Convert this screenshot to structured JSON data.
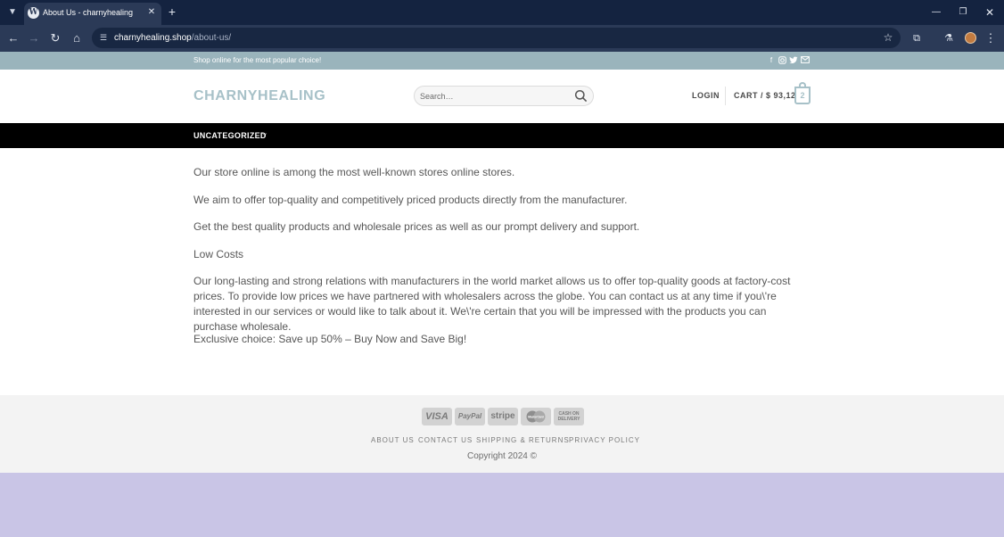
{
  "browser": {
    "tab_title": "About Us - charnyhealing",
    "url_host": "charnyhealing.shop",
    "url_path": "/about-us/"
  },
  "topbar": {
    "text": "Shop online for the most popular choice!",
    "social": [
      "facebook-icon",
      "instagram-icon",
      "twitter-icon",
      "email-icon"
    ]
  },
  "header": {
    "logo": "CHARNYHEALING",
    "search_placeholder": "Search…",
    "login": "LOGIN",
    "cart_label": "CART / $ 93,12",
    "cart_count": "2"
  },
  "nav": {
    "items": [
      {
        "label": "UNCATEGORIZED"
      }
    ]
  },
  "content": {
    "paragraphs": [
      "Our store online is among the most well-known stores online stores.",
      "We aim to offer top-quality and competitively priced products directly from the manufacturer.",
      "Get the best quality products and wholesale prices as well as our prompt delivery and support.",
      "Low Costs",
      "Our long-lasting and strong relations with manufacturers in the world market allows us to offer top-quality goods at factory-cost prices. To provide low prices we have partnered with wholesalers across the globe. You can contact us at any time if you\\'re interested in our services or would like to talk about it. We\\'re certain that you will be impressed with the products you can purchase wholesale.",
      "Exclusive choice: Save up 50% – Buy Now and Save Big!"
    ]
  },
  "footer": {
    "payments": [
      "VISA",
      "PayPal",
      "stripe",
      "MasterCard",
      "CASH ON DELIVERY"
    ],
    "links": [
      "ABOUT US",
      "CONTACT US",
      "SHIPPING & RETURNS",
      "PRIVACY POLICY"
    ],
    "copyright": "Copyright 2024 ©"
  },
  "colors": {
    "accent": "#a7c1c8",
    "topbar": "#9ab4bc",
    "nav_background": "#000000",
    "browser_frame": "#142340"
  }
}
